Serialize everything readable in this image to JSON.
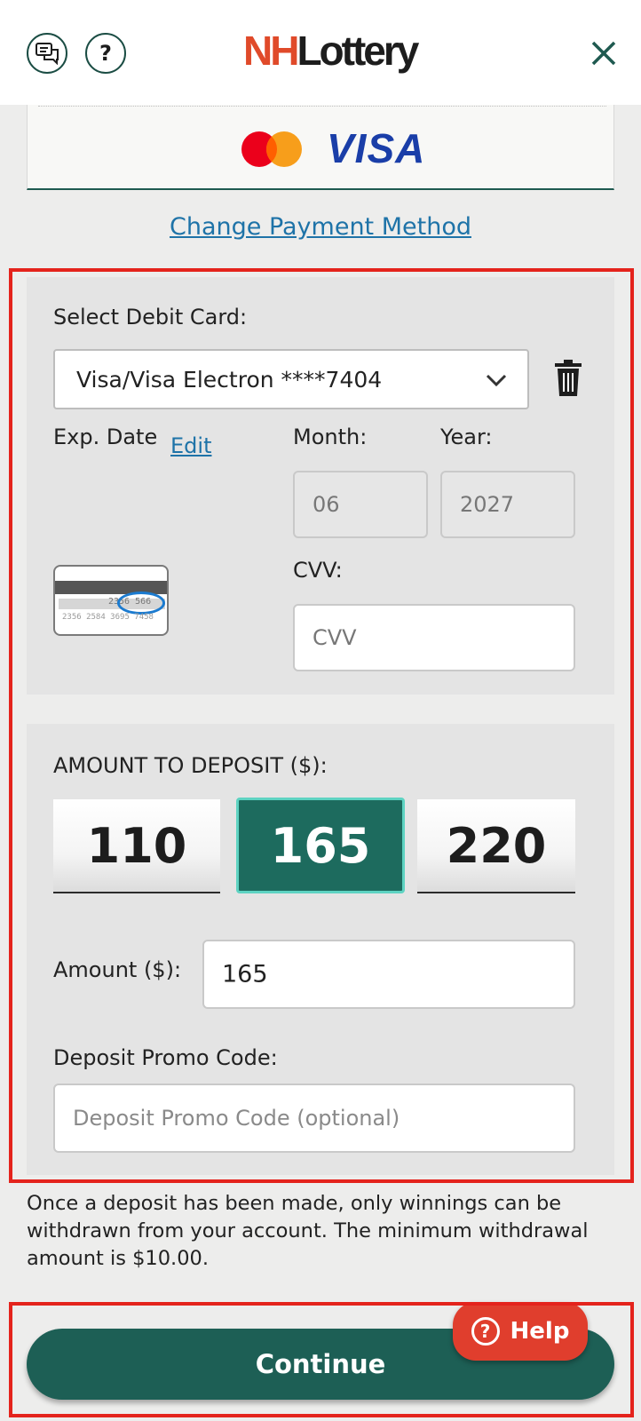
{
  "header": {
    "logo_prefix": "NH",
    "logo_rest": "Lottery",
    "help_glyph": "?"
  },
  "payment": {
    "brand_label": "VISA",
    "change_link": "Change Payment Method"
  },
  "card_form": {
    "select_label": "Select Debit Card:",
    "selected_card": "Visa/Visa Electron ****7404",
    "exp_label": "Exp. Date",
    "edit_label": "Edit",
    "month_label": "Month:",
    "year_label": "Year:",
    "month_value": "06",
    "year_value": "2027",
    "cvv_label": "CVV:",
    "cvv_placeholder": "CVV",
    "cvv_card_digits_top": "2356 566",
    "cvv_card_digits_bottom": "2356 2584 3695 7458"
  },
  "deposit": {
    "amount_label": "AMOUNT TO DEPOSIT ($):",
    "options": [
      "110",
      "165",
      "220"
    ],
    "selected_option": "165",
    "amount_field_label": "Amount ($):",
    "amount_value": "165",
    "promo_label": "Deposit Promo Code:",
    "promo_placeholder": "Deposit Promo Code (optional)"
  },
  "notice": "Once a deposit has been made, only winnings can be withdrawn from your account. The minimum withdrawal amount is $10.00.",
  "actions": {
    "continue_label": "Continue",
    "help_label": "Help",
    "help_glyph": "?"
  },
  "colors": {
    "brand_green": "#1d5f55",
    "selected_green": "#1d6b5e",
    "link_blue": "#1e73a8",
    "highlight_red": "#e4231c",
    "help_red": "#e03e2d",
    "visa_blue": "#1a3ea8"
  }
}
